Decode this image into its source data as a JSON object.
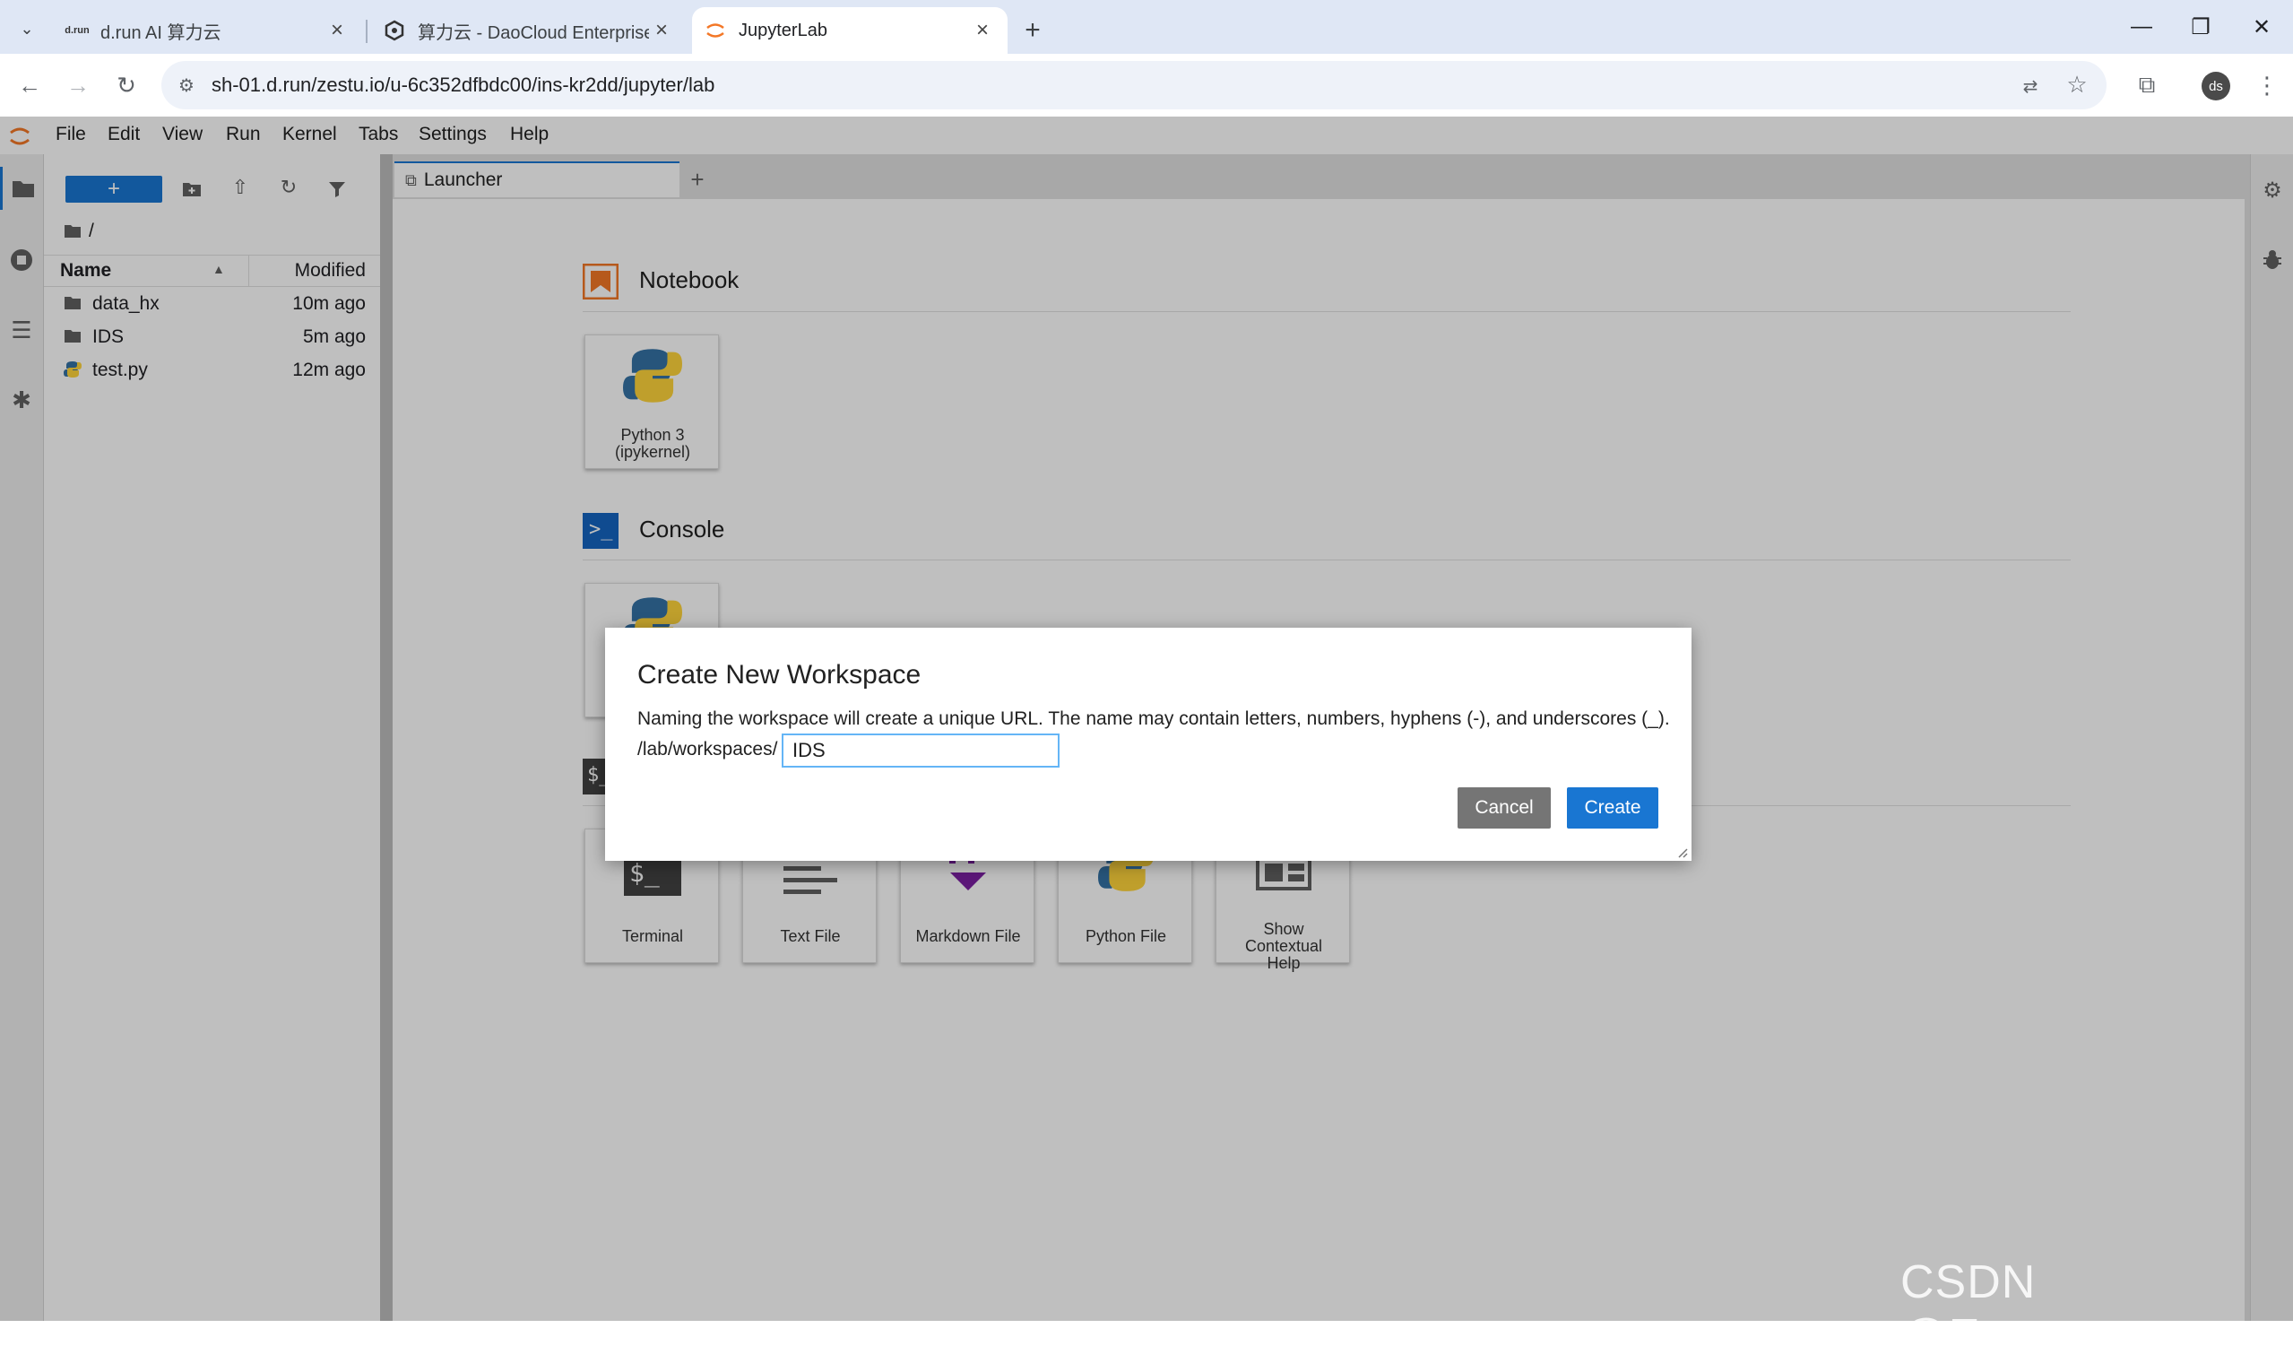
{
  "browser": {
    "tabs": [
      {
        "label": "d.run AI 算力云",
        "favicon": "d.run"
      },
      {
        "label": "算力云 - DaoCloud Enterprise"
      },
      {
        "label": "JupyterLab"
      }
    ],
    "url": "sh-01.d.run/zestu.io/u-6c352dfbdc00/ins-kr2dd/jupyter/lab",
    "profile": "ds"
  },
  "jupyter": {
    "menu": [
      "File",
      "Edit",
      "View",
      "Run",
      "Kernel",
      "Tabs",
      "Settings",
      "Help"
    ],
    "filebrowser": {
      "path": "/",
      "columns": {
        "name": "Name",
        "modified": "Modified"
      },
      "files": [
        {
          "name": "data_hx",
          "modified": "10m ago",
          "type": "folder"
        },
        {
          "name": "IDS",
          "modified": "5m ago",
          "type": "folder"
        },
        {
          "name": "test.py",
          "modified": "12m ago",
          "type": "python"
        }
      ]
    },
    "tab": {
      "label": "Launcher"
    },
    "launcher": {
      "notebook": {
        "title": "Notebook",
        "card_line1": "Python 3",
        "card_line2": "(ipykernel)"
      },
      "console": {
        "title": "Console"
      },
      "other_cards": [
        "Terminal",
        "Text File",
        "Markdown File",
        "Python File"
      ],
      "contextual_help": {
        "line1": "Show",
        "line2": "Contextual",
        "line3": "Help"
      }
    }
  },
  "dialog": {
    "title": "Create New Workspace",
    "body": "Naming the workspace will create a unique URL. The name may contain letters, numbers, hyphens (-), and underscores (_).",
    "prefix": "/lab/workspaces/",
    "input_value": "IDS",
    "cancel_label": "Cancel",
    "create_label": "Create",
    "cancel_color": "#757575",
    "create_color": "#1976d2"
  },
  "watermark": "CSDN @Eastmount"
}
